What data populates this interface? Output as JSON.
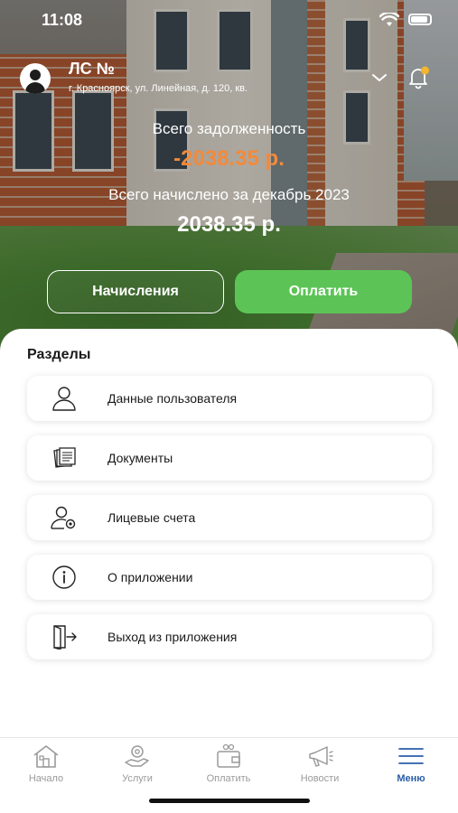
{
  "status_bar": {
    "time": "11:08"
  },
  "account": {
    "title": "ЛС №",
    "address": "г. Красноярск, ул. Линейная, д. 120, кв."
  },
  "summary": {
    "debt_label": "Всего задолженность",
    "debt_value": "-2038.35 р.",
    "charged_label": "Всего начислено за декабрь 2023",
    "charged_value": "2038.35 р."
  },
  "actions": {
    "charges_label": "Начисления",
    "pay_label": "Оплатить"
  },
  "sections": {
    "title": "Разделы",
    "items": [
      {
        "label": "Данные пользователя",
        "icon": "user-icon"
      },
      {
        "label": "Документы",
        "icon": "documents-icon"
      },
      {
        "label": "Лицевые счета",
        "icon": "user-settings-icon"
      },
      {
        "label": "О приложении",
        "icon": "info-icon"
      },
      {
        "label": "Выход из приложения",
        "icon": "logout-icon"
      }
    ]
  },
  "tabbar": {
    "items": [
      {
        "label": "Начало",
        "icon": "home-icon",
        "active": false
      },
      {
        "label": "Услуги",
        "icon": "services-icon",
        "active": false
      },
      {
        "label": "Оплатить",
        "icon": "wallet-icon",
        "active": false
      },
      {
        "label": "Новости",
        "icon": "megaphone-icon",
        "active": false
      },
      {
        "label": "Меню",
        "icon": "menu-icon",
        "active": true
      }
    ]
  },
  "colors": {
    "accent_green": "#5cc456",
    "debt_orange": "#f28a3c",
    "active_tab_blue": "#2b5ea7",
    "notification_dot": "#f5b52e"
  }
}
